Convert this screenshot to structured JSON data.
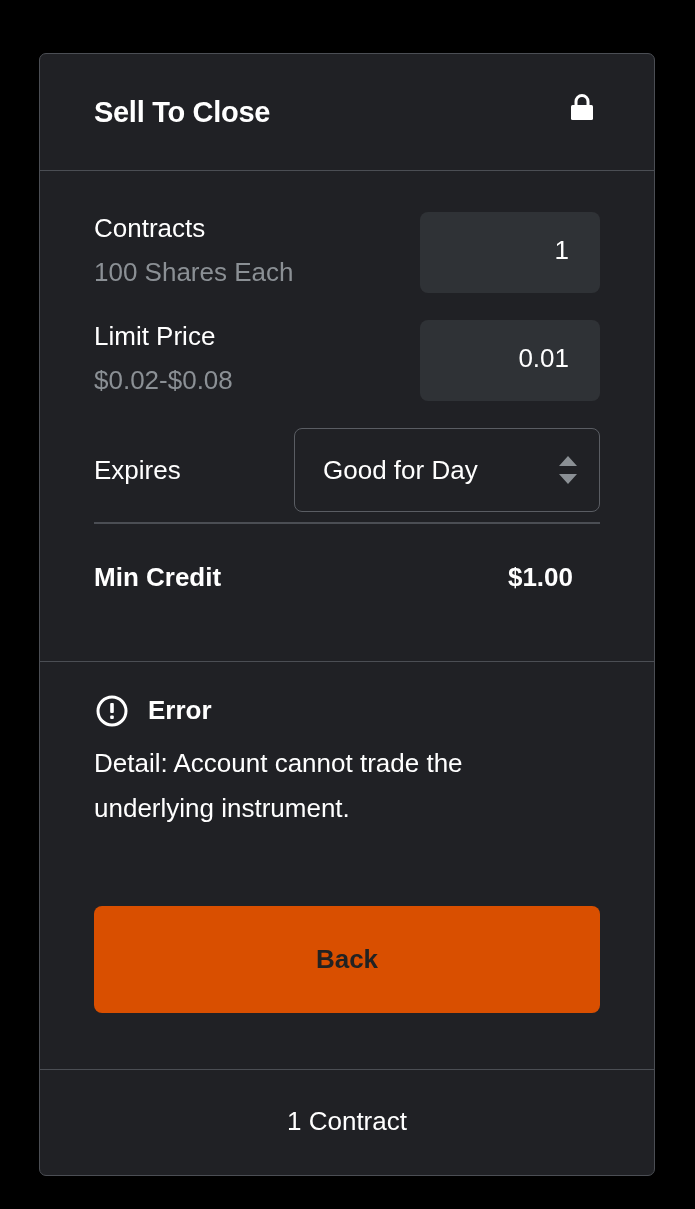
{
  "panel": {
    "title": "Sell To Close",
    "locked": true
  },
  "fields": [
    {
      "kind": "number",
      "label": "Contracts",
      "hint": "100 Shares Each",
      "value": "1"
    },
    {
      "kind": "number",
      "label": "Limit Price",
      "hint": "$0.02-$0.08",
      "value": "0.01"
    },
    {
      "kind": "select",
      "label": "Expires",
      "value": "Good for Day"
    }
  ],
  "summary": {
    "label": "Min Credit",
    "value": "$1.00"
  },
  "error": {
    "title": "Error",
    "detail": "Detail: Account cannot trade the underlying instrument."
  },
  "button": {
    "label": "Back"
  },
  "footer": {
    "text": "1 Contract"
  }
}
